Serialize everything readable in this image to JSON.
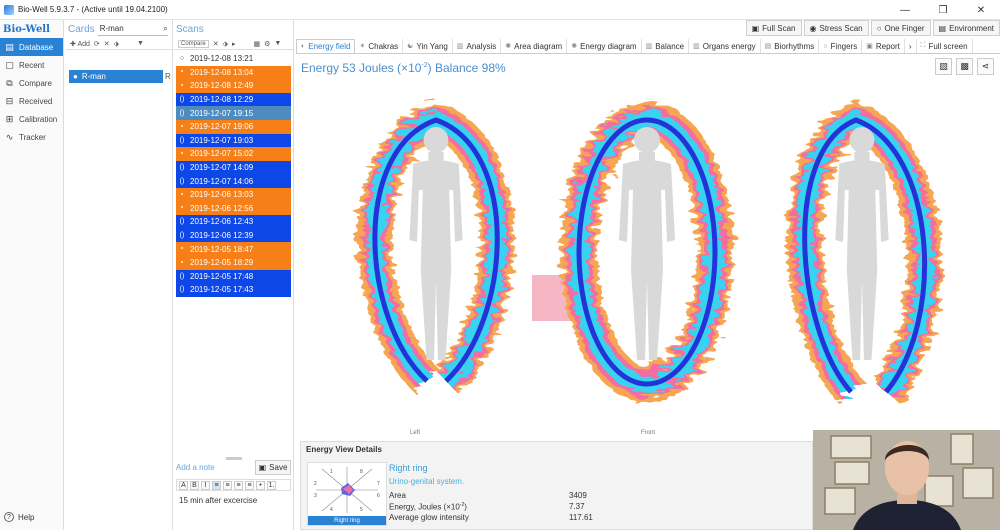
{
  "window": {
    "title": "Bio-Well 5.9.3.7 -  (Active until 19.04.2100)",
    "min_label": "—",
    "restore_label": "❐",
    "close_label": "✕"
  },
  "nav": {
    "logo": "Bio-Well",
    "items": [
      {
        "label": "Database",
        "icon": "database-icon"
      },
      {
        "label": "Recent",
        "icon": "document-icon"
      },
      {
        "label": "Compare",
        "icon": "compare-icon"
      },
      {
        "label": "Received",
        "icon": "inbox-icon"
      },
      {
        "label": "Calibration",
        "icon": "calibration-icon"
      },
      {
        "label": "Tracker",
        "icon": "pulse-icon"
      }
    ],
    "help": "Help"
  },
  "cards": {
    "title": "Cards",
    "search_value": "R-man",
    "add_label": "Add",
    "items": [
      {
        "name": "R-man",
        "tag": "R"
      }
    ]
  },
  "scans": {
    "title": "Scans",
    "compare_label": "Compare",
    "rows": [
      {
        "time": "2019-12-08 13:21",
        "style": "white",
        "mark": "○"
      },
      {
        "time": "2019-12-08 13:04",
        "style": "orange",
        "mark": "⬩"
      },
      {
        "time": "2019-12-08 12:49",
        "style": "orange",
        "mark": "⬩"
      },
      {
        "time": "2019-12-08 12:29",
        "style": "blue",
        "mark": "()"
      },
      {
        "time": "2019-12-07 19:15",
        "style": "gray",
        "mark": "()"
      },
      {
        "time": "2019-12-07 19:06",
        "style": "orange",
        "mark": "⬩"
      },
      {
        "time": "2019-12-07 19:03",
        "style": "blue",
        "mark": "()"
      },
      {
        "time": "2019-12-07 15:02",
        "style": "orange",
        "mark": "⬩"
      },
      {
        "time": "2019-12-07 14:09",
        "style": "blue",
        "mark": "()"
      },
      {
        "time": "2019-12-07 14:06",
        "style": "blue",
        "mark": "()"
      },
      {
        "time": "2019-12-06 13:03",
        "style": "orange",
        "mark": "⬩"
      },
      {
        "time": "2019-12-06 12:56",
        "style": "orange",
        "mark": "⬩"
      },
      {
        "time": "2019-12-06 12:43",
        "style": "blue",
        "mark": "()"
      },
      {
        "time": "2019-12-06 12:39",
        "style": "blue",
        "mark": "()"
      },
      {
        "time": "2019-12-05 18:47",
        "style": "orange",
        "mark": "⬩"
      },
      {
        "time": "2019-12-05 18:29",
        "style": "orange",
        "mark": "⬩"
      },
      {
        "time": "2019-12-05 17:48",
        "style": "blue",
        "mark": "()"
      },
      {
        "time": "2019-12-05 17:43",
        "style": "blue",
        "mark": "()"
      }
    ],
    "add_note": "Add a note",
    "save_label": "Save",
    "note_text": "15 min after excercise",
    "format_buttons": [
      "A",
      "B",
      "I",
      "≡",
      "≡",
      "≡",
      "≡",
      "•",
      "1."
    ]
  },
  "toolbar": {
    "buttons": [
      {
        "label": "Full Scan",
        "icon": "scan-icon"
      },
      {
        "label": "Stress Scan",
        "icon": "stress-icon"
      },
      {
        "label": "One Finger",
        "icon": "finger-icon"
      },
      {
        "label": "Environment",
        "icon": "environment-icon"
      }
    ]
  },
  "tabs": [
    {
      "label": "Energy field",
      "active": true
    },
    {
      "label": "Chakras"
    },
    {
      "label": "Yin Yang"
    },
    {
      "label": "Analysis"
    },
    {
      "label": "Area diagram"
    },
    {
      "label": "Energy diagram"
    },
    {
      "label": "Balance"
    },
    {
      "label": "Organs energy"
    },
    {
      "label": "Biorhythms"
    },
    {
      "label": "Fingers"
    },
    {
      "label": "Report"
    }
  ],
  "fullscreen_label": "Full screen",
  "energy": {
    "prefix": "Energy 53 Joules (×10",
    "exp": "-2",
    "suffix": ") Balance 98%"
  },
  "views": {
    "left": "Left",
    "front": "Front"
  },
  "details": {
    "header": "Energy View Details",
    "wheel_label": "Right ring",
    "wheel_numbers": [
      "1",
      "2",
      "3",
      "4",
      "5",
      "6",
      "7",
      "8"
    ],
    "title": "Right ring",
    "subtitle": "Urino-genital system.",
    "metrics": [
      {
        "label": "Area",
        "value": "3409"
      },
      {
        "label": "Energy, Joules (×10",
        "exp": "-2",
        "value": "7.37"
      },
      {
        "label": "Average glow intensity",
        "value": "117.61"
      }
    ]
  },
  "colors": {
    "accent": "#2a82d4",
    "orange": "#f77f17",
    "blue": "#0d47e8",
    "aura_cyan": "#39d3f0",
    "aura_blue": "#2333d8",
    "aura_pink": "#f36da0",
    "aura_orange": "#f6a552"
  }
}
